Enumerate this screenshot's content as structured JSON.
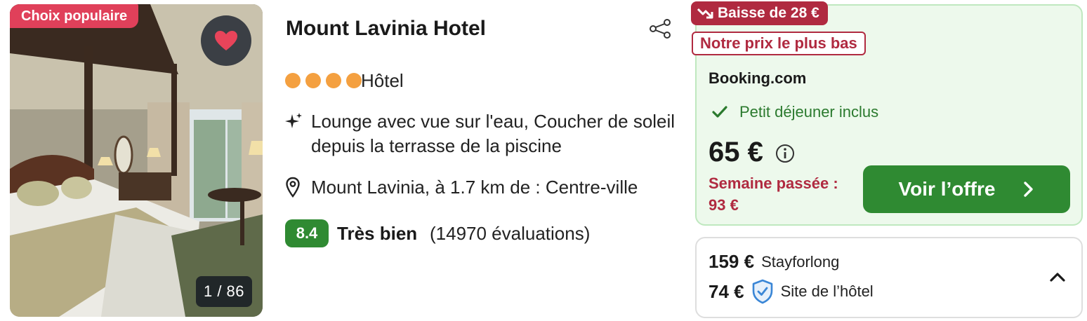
{
  "photo": {
    "badge": "Choix populaire",
    "counter": "1 / 86",
    "favorite_icon": "heart-icon"
  },
  "hotel": {
    "name": "Mount Lavinia Hotel",
    "star_count": 4,
    "type": "Hôtel",
    "amenities": "Lounge avec vue sur l'eau, Coucher de soleil depuis la terrasse de la piscine",
    "location": "Mount Lavinia, à 1.7 km de : Centre-ville",
    "rating": {
      "score": "8.4",
      "label": "Très bien",
      "count": "(14970 évaluations)"
    }
  },
  "offer": {
    "drop_badge": "Baisse de 28 €",
    "lowest_badge": "Notre prix le plus bas",
    "provider": "Booking.com",
    "perk": "Petit déjeuner inclus",
    "price": "65 €",
    "last_week": "Semaine passée : 93 €",
    "cta": "Voir l’offre"
  },
  "other_offers": [
    {
      "price": "159 €",
      "provider": "Stayforlong"
    },
    {
      "price": "74 €",
      "provider": "Site de l’hôtel"
    }
  ],
  "colors": {
    "brand_green": "#2f8a32",
    "price_drop_red": "#b02a40",
    "popular_badge": "#e0405a",
    "star_orange": "#f4a040",
    "offer_bg": "#edf9ec"
  }
}
